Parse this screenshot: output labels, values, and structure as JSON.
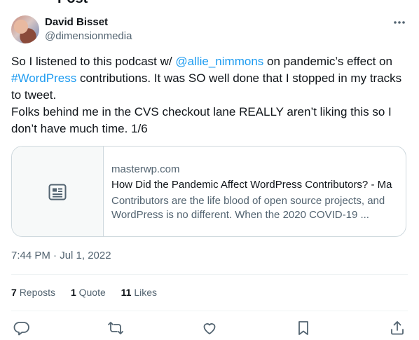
{
  "header_cut_text": "Post",
  "author": {
    "name": "David Bisset",
    "handle": "@dimensionmedia"
  },
  "tweet": {
    "part1": "So I listened to this podcast w/ ",
    "mention": "@allie_nimmons",
    "part2": "  on pandemic’s effect on ",
    "hashtag": "#WordPress",
    "part3": " contributions. It was SO well done that I stopped in my tracks to tweet.",
    "line2": "Folks behind me in the CVS checkout lane REALLY aren’t liking this so I don’t have much time. 1/6"
  },
  "card": {
    "domain": "masterwp.com",
    "title": "How Did the Pandemic Affect WordPress Contributors? - Ma",
    "description": "Contributors are the life blood of open source projects, and WordPress is no different. When the 2020 COVID-19 ..."
  },
  "timestamp": "7:44 PM · Jul 1, 2022",
  "stats": {
    "reposts_count": "7",
    "reposts_label": "Reposts",
    "quotes_count": "1",
    "quotes_label": "Quote",
    "likes_count": "11",
    "likes_label": "Likes"
  },
  "colors": {
    "accent": "#1d9bf0",
    "text": "#0f1419",
    "secondary": "#536471",
    "border": "#cfd9de"
  },
  "icons": [
    "more-icon",
    "article-icon",
    "reply-icon",
    "repost-icon",
    "like-icon",
    "bookmark-icon",
    "share-icon"
  ]
}
